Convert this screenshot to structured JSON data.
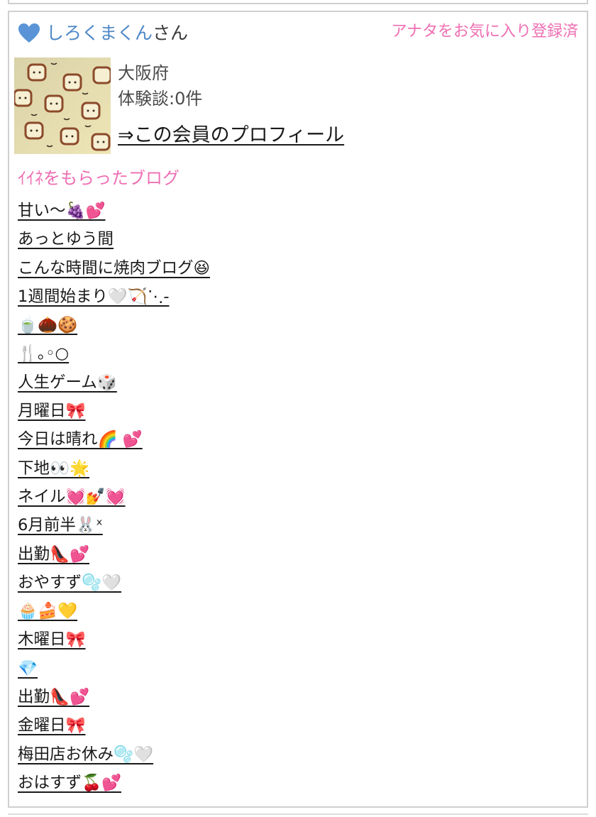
{
  "member": {
    "name": "しろくまくん",
    "suffix": "さん",
    "favorite_status": "アナタをお気に入り登録済",
    "region": "大阪府",
    "review_count": "体験談:0件",
    "profile_link": "⇒この会員のプロフィール",
    "avatar_description_icon": "bread-pattern-avatar"
  },
  "colors": {
    "name_blue": "#4f88c7",
    "accent_pink": "#ee6fb3",
    "border_gray": "#cfcfcf"
  },
  "liked_blogs": {
    "title": "ｲｲﾈをもらったブログ",
    "items": [
      "甘い〜🍇💕",
      "あっとゆう間",
      "こんな時間に焼肉ブログ😆",
      "1週間始まり🤍🏹⋱-",
      "🍵🌰🍪",
      "🍴｡◦○",
      "人生ゲーム🎲",
      "月曜日🎀",
      "今日は晴れ🌈 💕",
      "下地👀🌟",
      "ネイル💓💅💓",
      "6月前半🐰ˣ",
      "出勤👠💕",
      "おやすず🫧🤍",
      "🧁🍰💛",
      "木曜日🎀",
      "💎",
      "出勤👠💕",
      "金曜日🎀",
      "梅田店お休み🫧🤍",
      "おはすず🍒💕"
    ]
  }
}
